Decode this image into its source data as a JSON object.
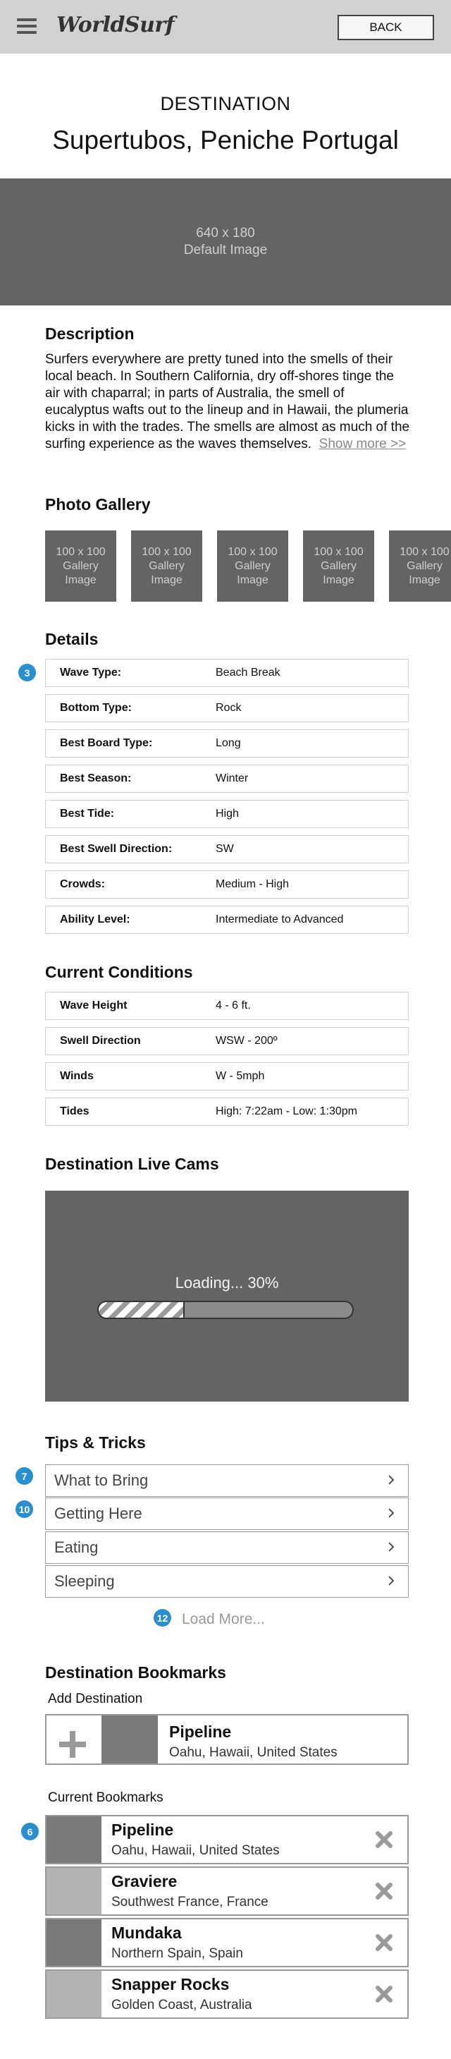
{
  "header": {
    "logo": "WorldSurf",
    "back_label": "BACK"
  },
  "destination": {
    "label": "DESTINATION",
    "title": "Supertubos, Peniche Portugal"
  },
  "hero": {
    "size_text": "640 x 180",
    "caption": "Default Image"
  },
  "description": {
    "heading": "Description",
    "text": "Surfers everywhere are pretty tuned into the smells of their local beach. In Southern California, dry off-shores tinge the air with chaparral; in parts of Australia, the smell of eucalyptus wafts out to the lineup and in Hawaii, the plumeria kicks in with the trades. The smells are almost as much of the surfing experience as the waves themselves.",
    "show_more": "Show more >>"
  },
  "gallery": {
    "heading": "Photo Gallery",
    "items": [
      {
        "size": "100 x 100",
        "line1": "Gallery",
        "line2": "Image"
      },
      {
        "size": "100 x 100",
        "line1": "Gallery",
        "line2": "Image"
      },
      {
        "size": "100 x 100",
        "line1": "Gallery",
        "line2": "Image"
      },
      {
        "size": "100 x 100",
        "line1": "Gallery",
        "line2": "Image"
      },
      {
        "size": "100 x 100",
        "line1": "Gallery",
        "line2": "Image"
      }
    ]
  },
  "details": {
    "heading": "Details",
    "badge": "3",
    "rows": [
      {
        "label": "Wave Type:",
        "value": "Beach Break"
      },
      {
        "label": "Bottom Type:",
        "value": "Rock"
      },
      {
        "label": "Best Board Type:",
        "value": "Long"
      },
      {
        "label": "Best Season:",
        "value": "Winter"
      },
      {
        "label": "Best Tide:",
        "value": "High"
      },
      {
        "label": "Best Swell Direction:",
        "value": "SW"
      },
      {
        "label": "Crowds:",
        "value": "Medium - High"
      },
      {
        "label": "Ability Level:",
        "value": "Intermediate to Advanced"
      }
    ]
  },
  "conditions": {
    "heading": "Current Conditions",
    "rows": [
      {
        "label": "Wave Height",
        "value": "4 - 6 ft."
      },
      {
        "label": "Swell Direction",
        "value": "WSW - 200º"
      },
      {
        "label": "Winds",
        "value": "W - 5mph"
      },
      {
        "label": "Tides",
        "value": "High: 7:22am -  Low: 1:30pm"
      }
    ]
  },
  "livecams": {
    "heading": "Destination Live Cams",
    "loading_text": "Loading... 30%",
    "progress": 0.34
  },
  "tips": {
    "heading": "Tips & Tricks",
    "items": [
      {
        "label": "What to Bring",
        "badge": "7"
      },
      {
        "label": "Getting Here",
        "badge": "10"
      },
      {
        "label": "Eating",
        "badge": ""
      },
      {
        "label": "Sleeping",
        "badge": ""
      }
    ],
    "load_more": "Load More...",
    "load_more_badge": "12"
  },
  "bookmarks": {
    "heading": "Destination Bookmarks",
    "add_label": "Add Destination",
    "add_item": {
      "name": "Pipeline",
      "location": "Oahu, Hawaii, United States"
    },
    "current_label": "Current Bookmarks",
    "badge": "6",
    "items": [
      {
        "name": "Pipeline",
        "location": "Oahu, Hawaii, United States",
        "thumb_color": "#7a7a7a"
      },
      {
        "name": "Graviere",
        "location": "Southwest France, France",
        "thumb_color": "#b3b3b3"
      },
      {
        "name": "Mundaka",
        "location": "Northern Spain, Spain",
        "thumb_color": "#7a7a7a"
      },
      {
        "name": "Snapper Rocks",
        "location": "Golden Coast, Australia",
        "thumb_color": "#b3b3b3"
      }
    ]
  },
  "colors": {
    "header_bg": "#d2d2d2",
    "placeholder_gray": "#646464",
    "badge_blue": "#2a8fcf"
  }
}
